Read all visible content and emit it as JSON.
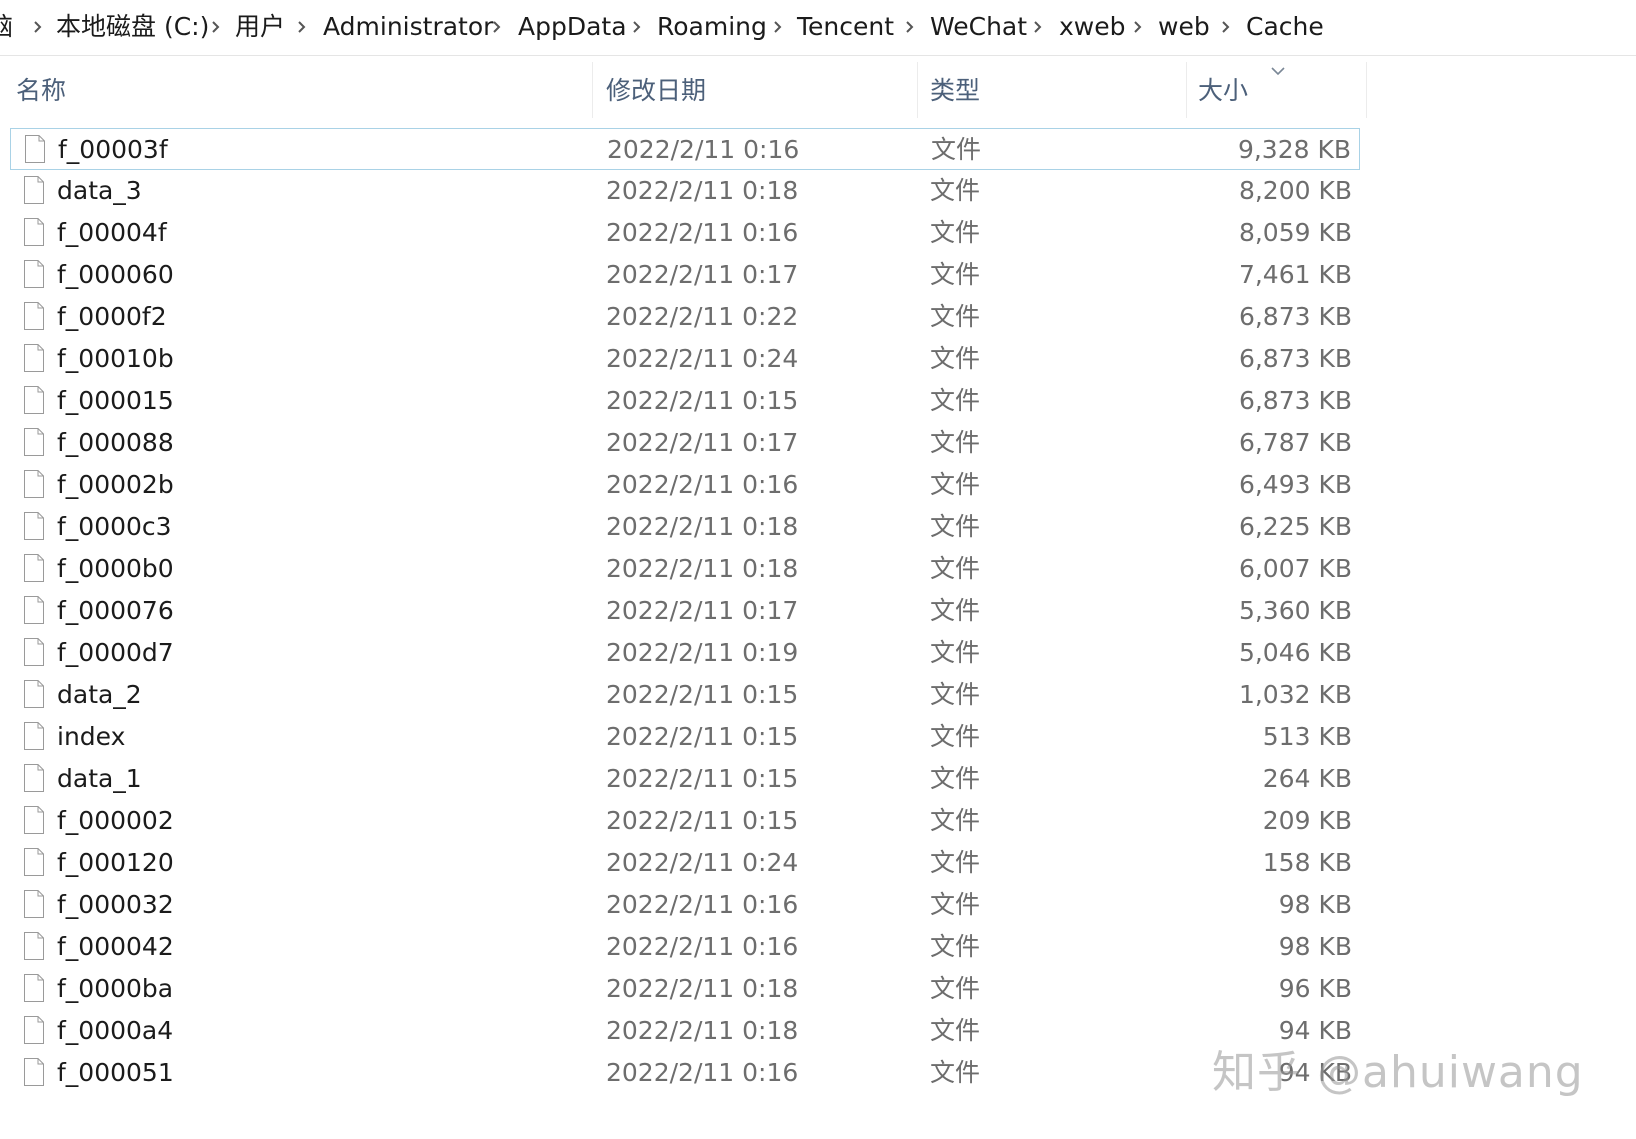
{
  "breadcrumb": {
    "items": [
      "脑",
      "本地磁盘 (C:)",
      "用户",
      "Administrator",
      "AppData",
      "Roaming",
      "Tencent",
      "WeChat",
      "xweb",
      "web",
      "Cache"
    ]
  },
  "columns": {
    "name": "名称",
    "date": "修改日期",
    "type": "类型",
    "size": "大小"
  },
  "files": [
    {
      "name": "f_00003f",
      "date": "2022/2/11 0:16",
      "type": "文件",
      "size": "9,328 KB"
    },
    {
      "name": "data_3",
      "date": "2022/2/11 0:18",
      "type": "文件",
      "size": "8,200 KB"
    },
    {
      "name": "f_00004f",
      "date": "2022/2/11 0:16",
      "type": "文件",
      "size": "8,059 KB"
    },
    {
      "name": "f_000060",
      "date": "2022/2/11 0:17",
      "type": "文件",
      "size": "7,461 KB"
    },
    {
      "name": "f_0000f2",
      "date": "2022/2/11 0:22",
      "type": "文件",
      "size": "6,873 KB"
    },
    {
      "name": "f_00010b",
      "date": "2022/2/11 0:24",
      "type": "文件",
      "size": "6,873 KB"
    },
    {
      "name": "f_000015",
      "date": "2022/2/11 0:15",
      "type": "文件",
      "size": "6,873 KB"
    },
    {
      "name": "f_000088",
      "date": "2022/2/11 0:17",
      "type": "文件",
      "size": "6,787 KB"
    },
    {
      "name": "f_00002b",
      "date": "2022/2/11 0:16",
      "type": "文件",
      "size": "6,493 KB"
    },
    {
      "name": "f_0000c3",
      "date": "2022/2/11 0:18",
      "type": "文件",
      "size": "6,225 KB"
    },
    {
      "name": "f_0000b0",
      "date": "2022/2/11 0:18",
      "type": "文件",
      "size": "6,007 KB"
    },
    {
      "name": "f_000076",
      "date": "2022/2/11 0:17",
      "type": "文件",
      "size": "5,360 KB"
    },
    {
      "name": "f_0000d7",
      "date": "2022/2/11 0:19",
      "type": "文件",
      "size": "5,046 KB"
    },
    {
      "name": "data_2",
      "date": "2022/2/11 0:15",
      "type": "文件",
      "size": "1,032 KB"
    },
    {
      "name": "index",
      "date": "2022/2/11 0:15",
      "type": "文件",
      "size": "513 KB"
    },
    {
      "name": "data_1",
      "date": "2022/2/11 0:15",
      "type": "文件",
      "size": "264 KB"
    },
    {
      "name": "f_000002",
      "date": "2022/2/11 0:15",
      "type": "文件",
      "size": "209 KB"
    },
    {
      "name": "f_000120",
      "date": "2022/2/11 0:24",
      "type": "文件",
      "size": "158 KB"
    },
    {
      "name": "f_000032",
      "date": "2022/2/11 0:16",
      "type": "文件",
      "size": "98 KB"
    },
    {
      "name": "f_000042",
      "date": "2022/2/11 0:16",
      "type": "文件",
      "size": "98 KB"
    },
    {
      "name": "f_0000ba",
      "date": "2022/2/11 0:18",
      "type": "文件",
      "size": "96 KB"
    },
    {
      "name": "f_0000a4",
      "date": "2022/2/11 0:18",
      "type": "文件",
      "size": "94 KB"
    },
    {
      "name": "f_000051",
      "date": "2022/2/11 0:16",
      "type": "文件",
      "size": "94 KB"
    }
  ],
  "selected_index": 0,
  "watermark": "知乎 @ahuiwang",
  "colors": {
    "header_text": "#4c607a",
    "selection_border": "#a9d2e6"
  }
}
